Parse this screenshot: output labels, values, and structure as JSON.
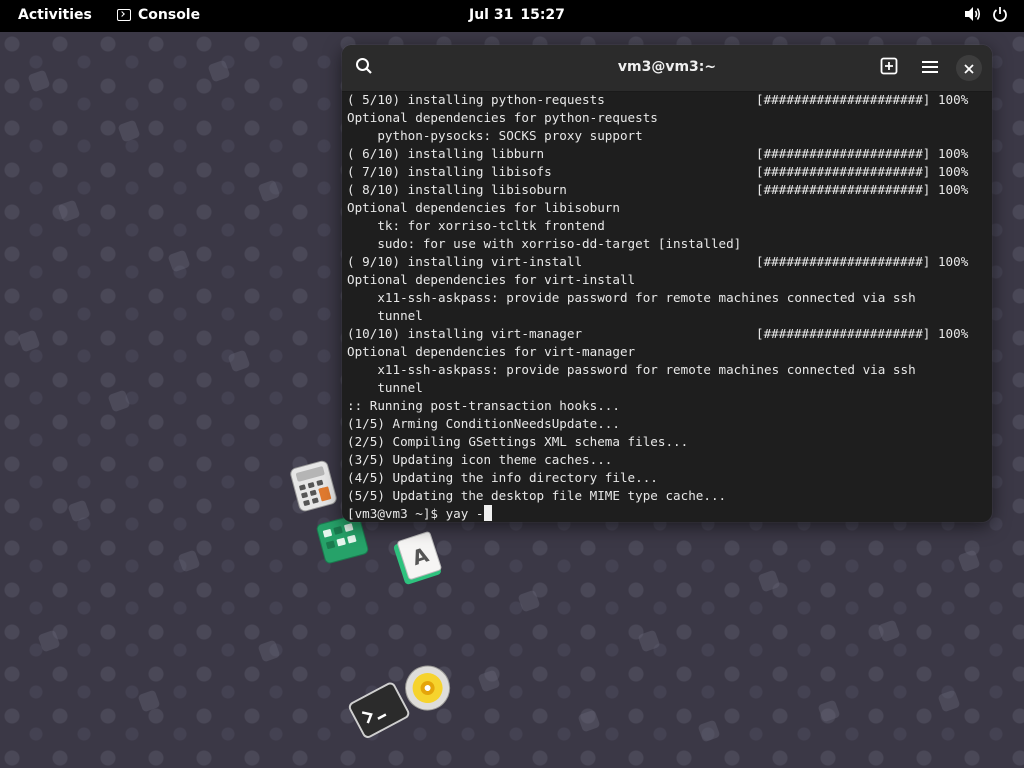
{
  "topbar": {
    "activities": "Activities",
    "app_name": "Console",
    "app_icon": "terminal-icon",
    "date": "Jul 31",
    "time": "15:27",
    "volume_icon": "volume-icon",
    "power_icon": "power-icon"
  },
  "terminal": {
    "title": "vm3@vm3:~",
    "lines": [
      {
        "text": "( 5/10) installing python-requests",
        "bar": "[#####################] 100%"
      },
      {
        "text": "Optional dependencies for python-requests"
      },
      {
        "text": "    python-pysocks: SOCKS proxy support"
      },
      {
        "text": "( 6/10) installing libburn",
        "bar": "[#####################] 100%"
      },
      {
        "text": "( 7/10) installing libisofs",
        "bar": "[#####################] 100%"
      },
      {
        "text": "( 8/10) installing libisoburn",
        "bar": "[#####################] 100%"
      },
      {
        "text": "Optional dependencies for libisoburn"
      },
      {
        "text": "    tk: for xorriso-tcltk frontend"
      },
      {
        "text": "    sudo: for use with xorriso-dd-target [installed]"
      },
      {
        "text": "( 9/10) installing virt-install",
        "bar": "[#####################] 100%"
      },
      {
        "text": "Optional dependencies for virt-install"
      },
      {
        "text": "    x11-ssh-askpass: provide password for remote machines connected via ssh"
      },
      {
        "text": "    tunnel"
      },
      {
        "text": "(10/10) installing virt-manager",
        "bar": "[#####################] 100%"
      },
      {
        "text": "Optional dependencies for virt-manager"
      },
      {
        "text": "    x11-ssh-askpass: provide password for remote machines connected via ssh"
      },
      {
        "text": "    tunnel"
      },
      {
        "text": ":: Running post-transaction hooks..."
      },
      {
        "text": "(1/5) Arming ConditionNeedsUpdate..."
      },
      {
        "text": "(2/5) Compiling GSettings XML schema files..."
      },
      {
        "text": "(3/5) Updating icon theme caches..."
      },
      {
        "text": "(4/5) Updating the info directory file..."
      },
      {
        "text": "(5/5) Updating the desktop file MIME type cache..."
      }
    ],
    "prompt": "[vm3@vm3 ~]$ ",
    "command": "yay -"
  },
  "desktop_icons": [
    "calculator-icon",
    "calendar-icon",
    "dictionary-icon",
    "terminal-icon",
    "disk-usage-icon"
  ],
  "colors": {
    "terminal_bg": "#1e1e1e",
    "header_bg": "#2b2b2b",
    "wallpaper": "#3b3846",
    "topbar": "#000000"
  }
}
